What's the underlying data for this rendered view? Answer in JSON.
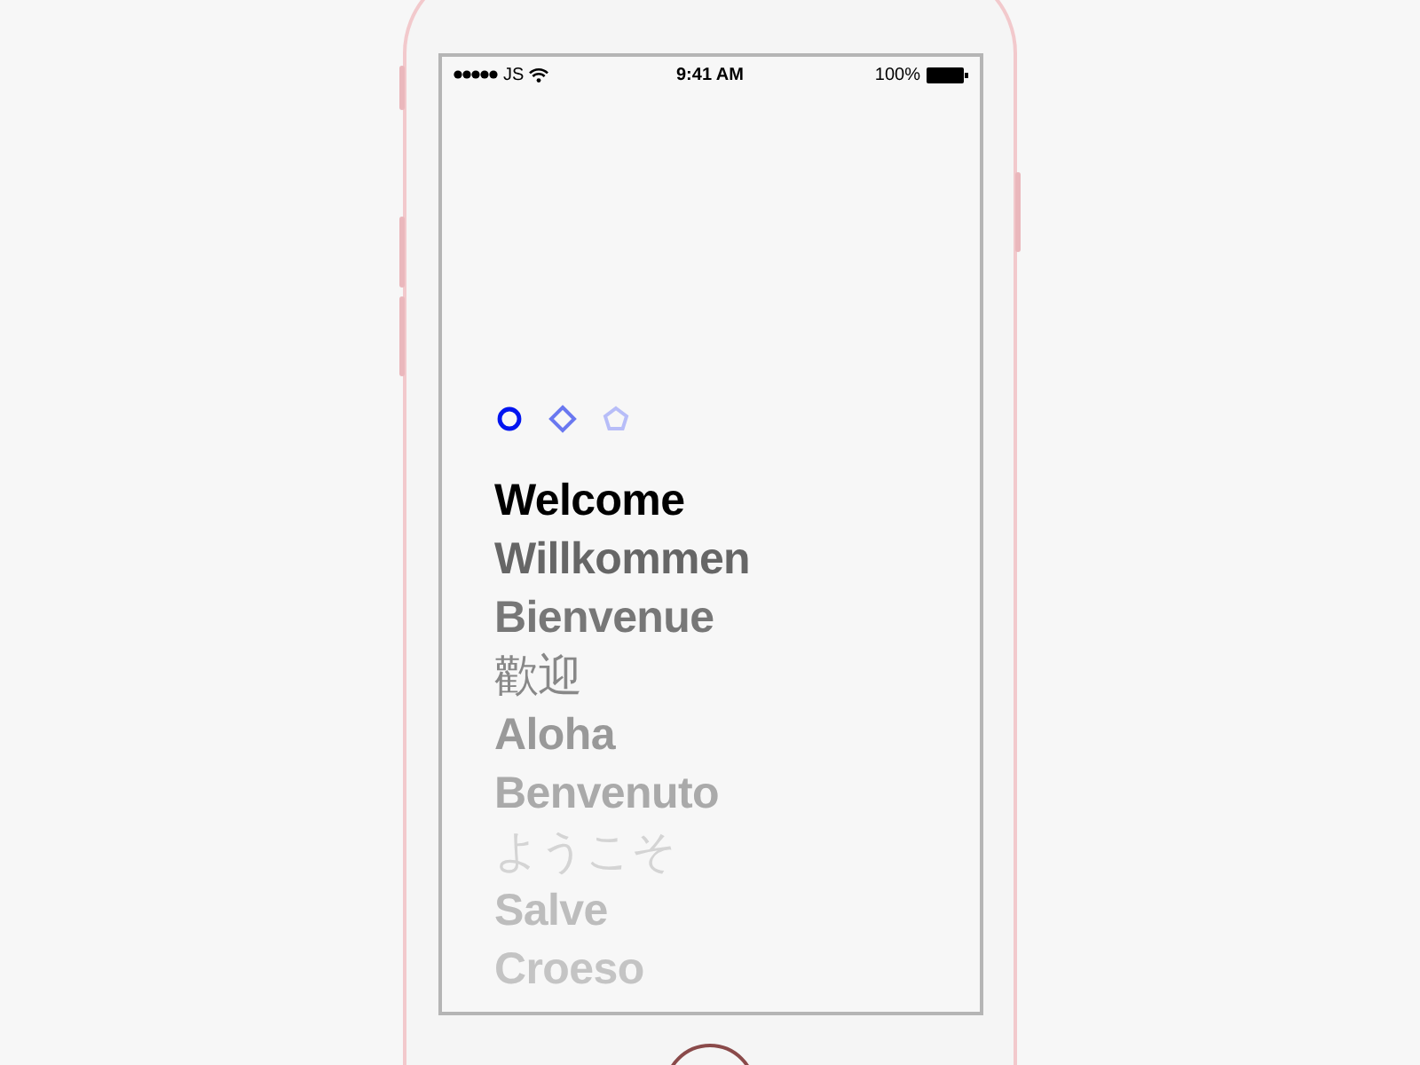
{
  "status_bar": {
    "carrier": "JS",
    "time": "9:41 AM",
    "battery": "100%"
  },
  "page_indicator": [
    {
      "kind": "circle",
      "selected": true
    },
    {
      "kind": "diamond",
      "selected": false
    },
    {
      "kind": "pentagon",
      "selected": false
    }
  ],
  "greetings": [
    {
      "text": "Welcome",
      "color": "#000000"
    },
    {
      "text": "Willkommen",
      "color": "#666666"
    },
    {
      "text": "Bienvenue",
      "color": "#777777"
    },
    {
      "text": "歡迎",
      "color": "#888888"
    },
    {
      "text": "Aloha",
      "color": "#999999"
    },
    {
      "text": "Benvenuto",
      "color": "#aaaaaa"
    },
    {
      "text": "ようこそ",
      "color": "#d4d4d4"
    },
    {
      "text": "Salve",
      "color": "#bdbdbd"
    },
    {
      "text": "Croeso",
      "color": "#c4c4c4"
    }
  ]
}
